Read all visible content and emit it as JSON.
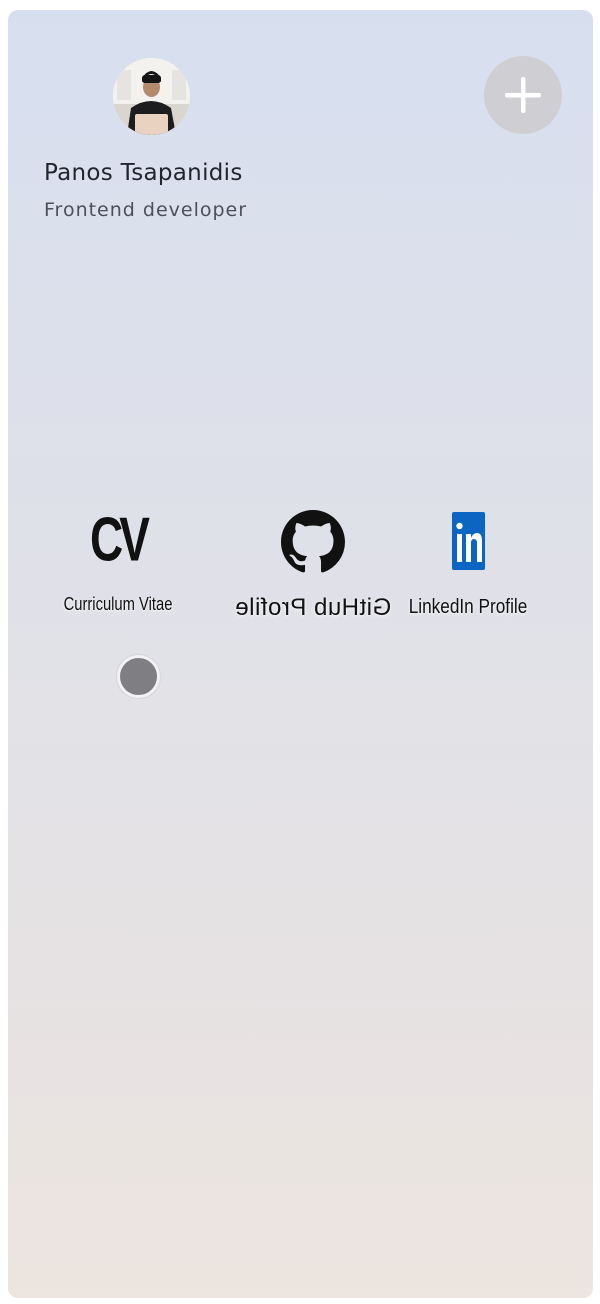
{
  "profile": {
    "name": "Panos Tsapanidis",
    "role": "Frontend developer"
  },
  "links": {
    "cv": {
      "logo_text": "CV",
      "label": "Curriculum Vitae"
    },
    "github": {
      "label": "GitHub Profile",
      "icon": "github-icon"
    },
    "linkedin": {
      "label": "LinkedIn Profile",
      "icon": "linkedin-icon",
      "color": "#0a66c2"
    }
  },
  "actions": {
    "add_icon": "plus-icon"
  }
}
